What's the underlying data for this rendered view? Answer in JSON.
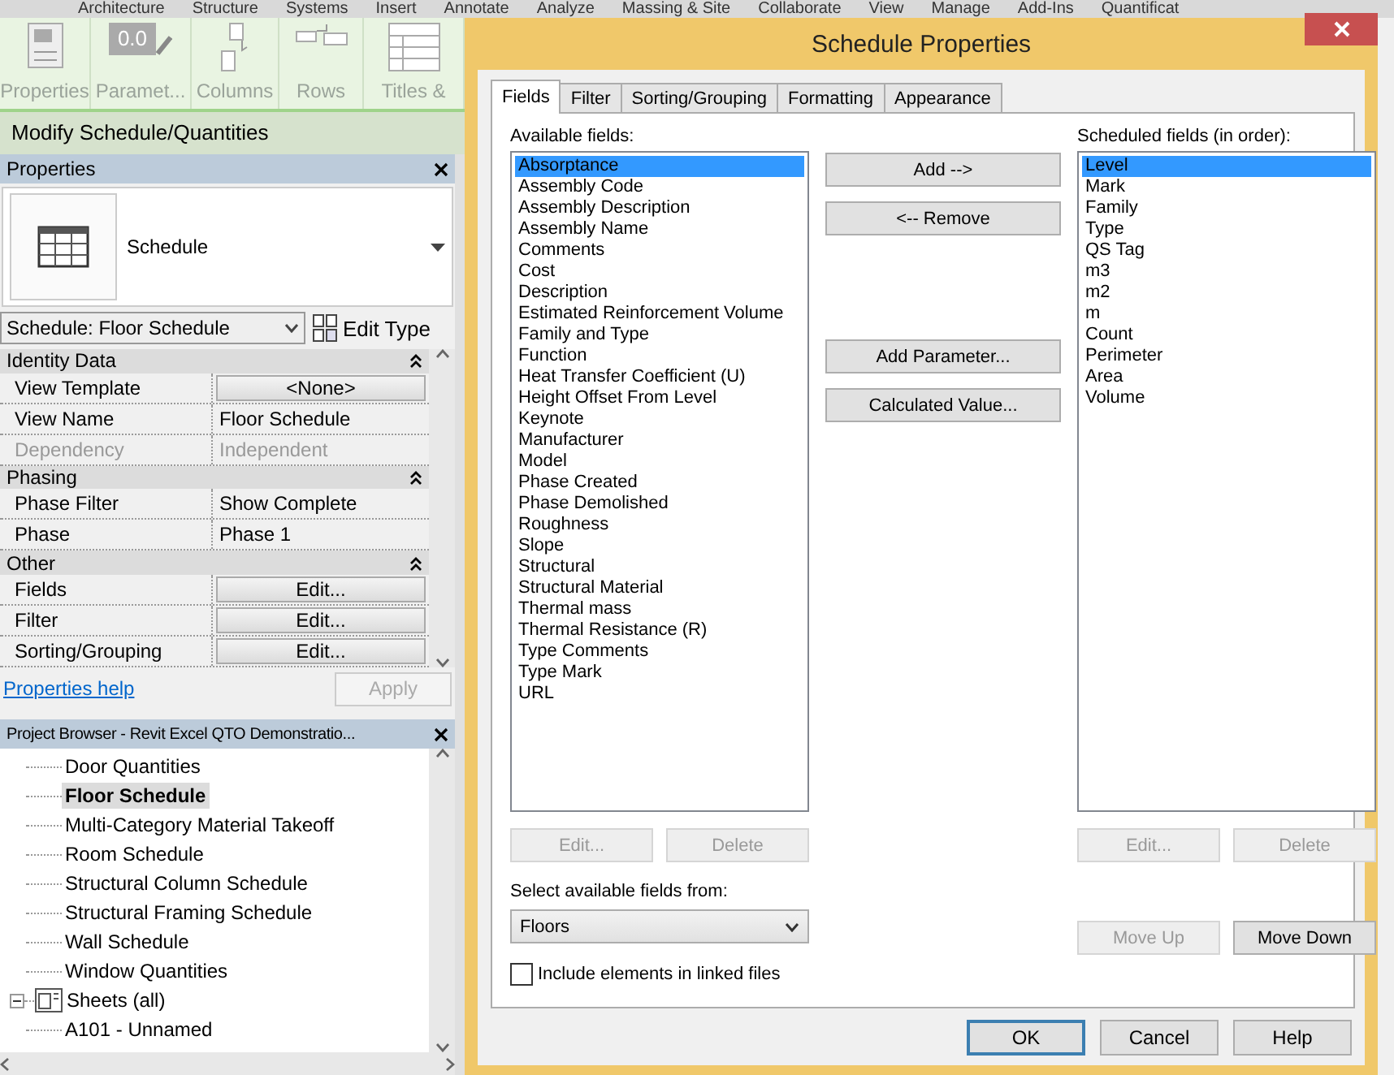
{
  "ribbon_tabs": [
    "Architecture",
    "Structure",
    "Systems",
    "Insert",
    "Annotate",
    "Analyze",
    "Massing & Site",
    "Collaborate",
    "View",
    "Manage",
    "Add-Ins",
    "Quantificat"
  ],
  "ribbon_buttons": [
    {
      "label": "Properties",
      "kind": "properties"
    },
    {
      "label": "Paramet...",
      "kind": "parameter",
      "icon_text": "0.0"
    },
    {
      "label": "Columns",
      "kind": "columns"
    },
    {
      "label": "Rows",
      "kind": "rows"
    },
    {
      "label": "Titles &",
      "kind": "titles"
    }
  ],
  "context_tab": "Modify Schedule/Quantities",
  "properties": {
    "title": "Properties",
    "type_name": "Schedule",
    "instance_selector": "Schedule: Floor Schedule",
    "edit_type": "Edit Type",
    "groups": [
      {
        "name": "Identity Data",
        "rows": [
          {
            "name": "View Template",
            "value": "<None>",
            "kind": "button",
            "disabled": false
          },
          {
            "name": "View Name",
            "value": "Floor Schedule",
            "kind": "text",
            "disabled": false
          },
          {
            "name": "Dependency",
            "value": "Independent",
            "kind": "text",
            "disabled": true
          }
        ]
      },
      {
        "name": "Phasing",
        "rows": [
          {
            "name": "Phase Filter",
            "value": "Show Complete",
            "kind": "text",
            "disabled": false
          },
          {
            "name": "Phase",
            "value": "Phase 1",
            "kind": "text",
            "disabled": false
          }
        ]
      },
      {
        "name": "Other",
        "rows": [
          {
            "name": "Fields",
            "value": "Edit...",
            "kind": "button",
            "disabled": false
          },
          {
            "name": "Filter",
            "value": "Edit...",
            "kind": "button",
            "disabled": false
          },
          {
            "name": "Sorting/Grouping",
            "value": "Edit...",
            "kind": "button",
            "disabled": false
          }
        ]
      }
    ],
    "help_link": "Properties help",
    "apply": {
      "label": "Apply",
      "disabled": true
    }
  },
  "project_browser": {
    "title": "Project Browser - Revit Excel QTO Demonstratio...",
    "items": [
      {
        "label": "Door Quantities",
        "selected": false
      },
      {
        "label": "Floor Schedule",
        "selected": true
      },
      {
        "label": "Multi-Category Material Takeoff",
        "selected": false
      },
      {
        "label": "Room Schedule",
        "selected": false
      },
      {
        "label": "Structural Column Schedule",
        "selected": false
      },
      {
        "label": "Structural Framing Schedule",
        "selected": false
      },
      {
        "label": "Wall Schedule",
        "selected": false
      },
      {
        "label": "Window Quantities",
        "selected": false
      },
      {
        "label": "Sheets (all)",
        "selected": false,
        "expanded": true,
        "children": [
          {
            "label": "A101 - Unnamed",
            "selected": false
          }
        ]
      }
    ]
  },
  "dialog": {
    "title": "Schedule Properties",
    "tabs": [
      {
        "label": "Fields",
        "selected": true
      },
      {
        "label": "Filter",
        "selected": false
      },
      {
        "label": "Sorting/Grouping",
        "selected": false
      },
      {
        "label": "Formatting",
        "selected": false
      },
      {
        "label": "Appearance",
        "selected": false
      }
    ],
    "available_label": "Available fields:",
    "available_fields": [
      {
        "label": "Absorptance",
        "selected": true
      },
      {
        "label": "Assembly Code",
        "selected": false
      },
      {
        "label": "Assembly Description",
        "selected": false
      },
      {
        "label": "Assembly Name",
        "selected": false
      },
      {
        "label": "Comments",
        "selected": false
      },
      {
        "label": "Cost",
        "selected": false
      },
      {
        "label": "Description",
        "selected": false
      },
      {
        "label": "Estimated Reinforcement Volume",
        "selected": false
      },
      {
        "label": "Family and Type",
        "selected": false
      },
      {
        "label": "Function",
        "selected": false
      },
      {
        "label": "Heat Transfer Coefficient (U)",
        "selected": false
      },
      {
        "label": "Height Offset From Level",
        "selected": false
      },
      {
        "label": "Keynote",
        "selected": false
      },
      {
        "label": "Manufacturer",
        "selected": false
      },
      {
        "label": "Model",
        "selected": false
      },
      {
        "label": "Phase Created",
        "selected": false
      },
      {
        "label": "Phase Demolished",
        "selected": false
      },
      {
        "label": "Roughness",
        "selected": false
      },
      {
        "label": "Slope",
        "selected": false
      },
      {
        "label": "Structural",
        "selected": false
      },
      {
        "label": "Structural Material",
        "selected": false
      },
      {
        "label": "Thermal mass",
        "selected": false
      },
      {
        "label": "Thermal Resistance (R)",
        "selected": false
      },
      {
        "label": "Type Comments",
        "selected": false
      },
      {
        "label": "Type Mark",
        "selected": false
      },
      {
        "label": "URL",
        "selected": false
      }
    ],
    "middle_buttons": [
      {
        "label": "Add -->",
        "disabled": false
      },
      {
        "label": "<-- Remove",
        "disabled": false
      },
      {
        "label": "Add Parameter...",
        "disabled": false
      },
      {
        "label": "Calculated Value...",
        "disabled": false
      }
    ],
    "scheduled_label": "Scheduled fields (in order):",
    "scheduled_fields": [
      {
        "label": "Level",
        "selected": true
      },
      {
        "label": "Mark",
        "selected": false
      },
      {
        "label": "Family",
        "selected": false
      },
      {
        "label": "Type",
        "selected": false
      },
      {
        "label": "QS Tag",
        "selected": false
      },
      {
        "label": "m3",
        "selected": false
      },
      {
        "label": "m2",
        "selected": false
      },
      {
        "label": "m",
        "selected": false
      },
      {
        "label": "Count",
        "selected": false
      },
      {
        "label": "Perimeter",
        "selected": false
      },
      {
        "label": "Area",
        "selected": false
      },
      {
        "label": "Volume",
        "selected": false
      }
    ],
    "left_buttons": [
      {
        "label": "Edit...",
        "disabled": true
      },
      {
        "label": "Delete",
        "disabled": true
      }
    ],
    "right_buttons": [
      {
        "label": "Edit...",
        "disabled": true
      },
      {
        "label": "Delete",
        "disabled": true
      }
    ],
    "source_label": "Select available fields from:",
    "source_value": "Floors",
    "move_buttons": [
      {
        "label": "Move Up",
        "disabled": true
      },
      {
        "label": "Move Down",
        "disabled": false
      }
    ],
    "include_linked": {
      "label": "Include elements in linked files",
      "checked": false
    },
    "footer_buttons": [
      {
        "label": "OK",
        "default": true
      },
      {
        "label": "Cancel",
        "default": false
      },
      {
        "label": "Help",
        "default": false
      }
    ]
  }
}
